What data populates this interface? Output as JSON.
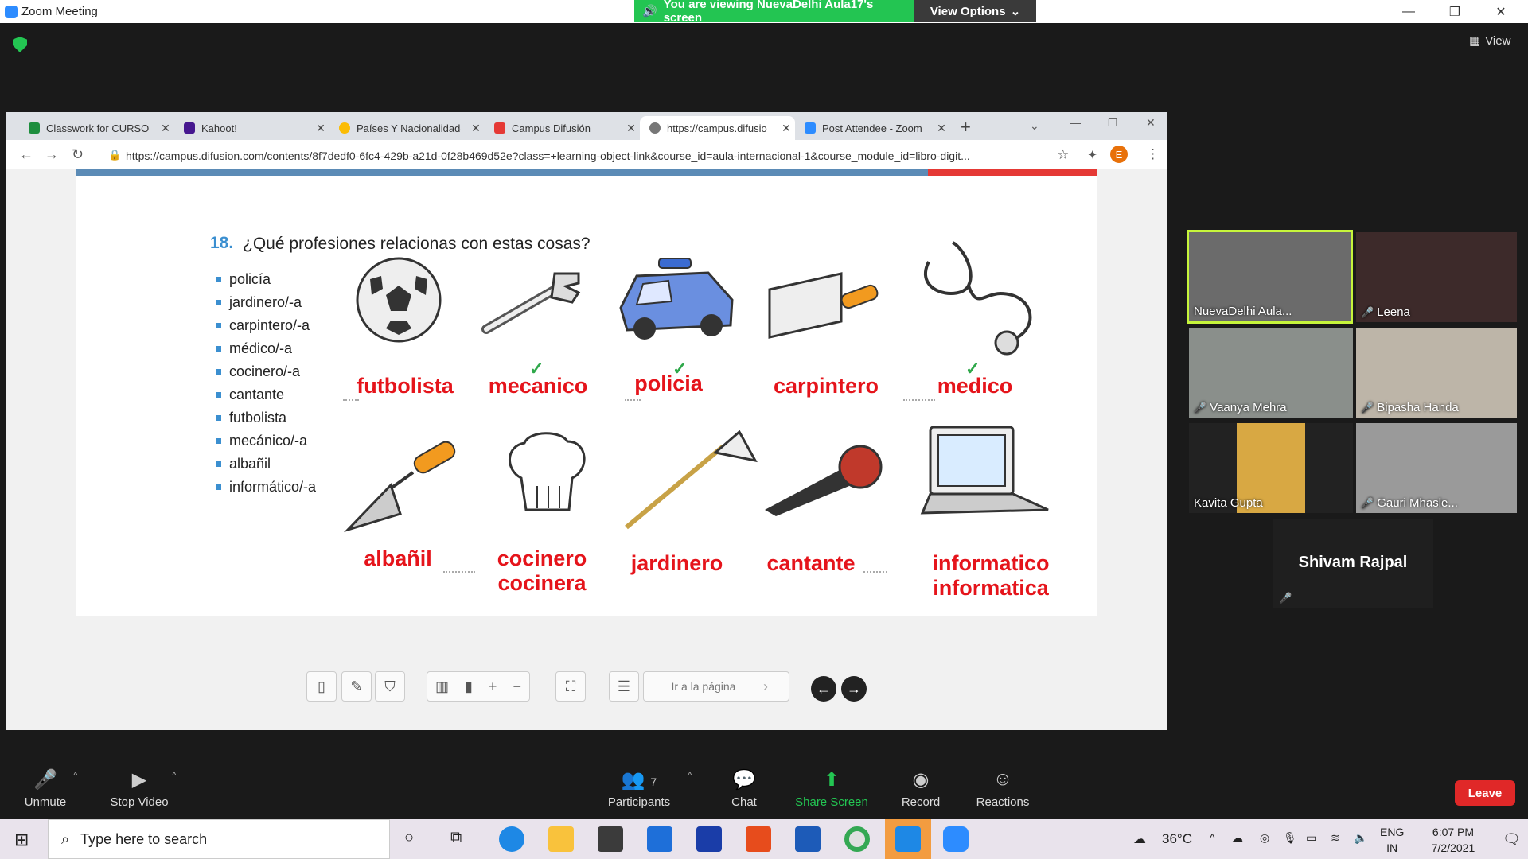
{
  "zoom": {
    "window_title": "Zoom Meeting",
    "share_banner": "You are viewing NuevaDelhi Aula17's screen",
    "view_options": "View Options",
    "view_button": "View",
    "colors": {
      "banner": "#23c552",
      "leave": "#e02828",
      "brand": "#2d8cff"
    }
  },
  "browser": {
    "tabs": [
      {
        "label": "Classwork for CURSO",
        "icon": "classroom-icon"
      },
      {
        "label": "Kahoot!",
        "icon": "kahoot-icon"
      },
      {
        "label": "Países Y Nacionalidade",
        "icon": "globe-icon"
      },
      {
        "label": "Campus Difusión",
        "icon": "difusion-icon"
      },
      {
        "label": "https://campus.difusio",
        "icon": "globe-icon"
      },
      {
        "label": "Post Attendee - Zoom",
        "icon": "zoom-icon"
      }
    ],
    "new_tab": "+",
    "url": "https://campus.difusion.com/contents/8f7dedf0-6fc4-429b-a21d-0f28b469d52e?class=+learning-object-link&course_id=aula-internacional-1&course_module_id=libro-digit...",
    "profile_initial": "E"
  },
  "exercise": {
    "number": "18.",
    "title": "¿Qué profesiones relacionas con estas cosas?",
    "list": [
      "policía",
      "jardinero/-a",
      "carpintero/-a",
      "médico/-a",
      "cocinero/-a",
      "cantante",
      "futbolista",
      "mecánico/-a",
      "albañil",
      "informático/-a"
    ],
    "answers_row1": [
      "futbolista",
      "mecanico",
      "policia",
      "carpintero",
      "medico"
    ],
    "answers_row2": [
      "albañil",
      "cocinero",
      "cocinera",
      "jardinero",
      "cantante",
      "informatico",
      "informatica"
    ],
    "images": [
      "soccer-ball",
      "wrench",
      "police-car",
      "saw",
      "stethoscope",
      "trowel",
      "chef-hat",
      "rake",
      "microphone",
      "laptop"
    ]
  },
  "viewer_toolbar": {
    "page_placeholder": "Ir a la página"
  },
  "participants": [
    {
      "name": "NuevaDelhi Aula...",
      "muted": false,
      "active": true
    },
    {
      "name": "Leena",
      "muted": true
    },
    {
      "name": "Vaanya Mehra",
      "muted": true
    },
    {
      "name": "Bipasha Handa",
      "muted": true
    },
    {
      "name": "Kavita Gupta",
      "muted": false
    },
    {
      "name": "Gauri Mhasle...",
      "muted": true
    },
    {
      "name": "Shivam Rajpal",
      "muted": true
    }
  ],
  "controls": {
    "unmute": "Unmute",
    "stop_video": "Stop Video",
    "participants": "Participants",
    "participants_count": "7",
    "chat": "Chat",
    "share_screen": "Share Screen",
    "record": "Record",
    "reactions": "Reactions",
    "leave": "Leave"
  },
  "taskbar": {
    "search_placeholder": "Type here to search",
    "temperature": "36°C",
    "lang": "ENG",
    "region": "IN",
    "time": "6:07 PM",
    "date": "7/2/2021"
  }
}
